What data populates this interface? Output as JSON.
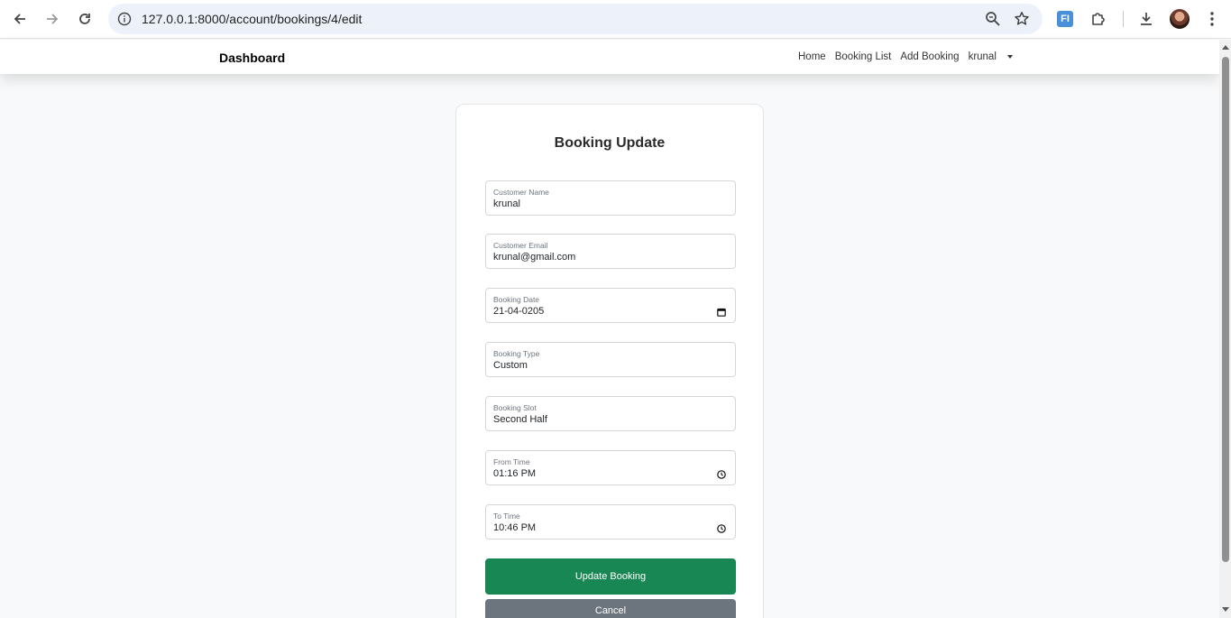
{
  "browser": {
    "url": "127.0.0.1:8000/account/bookings/4/edit",
    "extension_label": "FI"
  },
  "navbar": {
    "brand": "Dashboard",
    "links": [
      "Home",
      "Booking List",
      "Add Booking"
    ],
    "user": "krunal"
  },
  "form": {
    "title": "Booking Update",
    "fields": [
      {
        "label": "Customer Name",
        "value": "krunal"
      },
      {
        "label": "Customer Email",
        "value": "krunal@gmail.com"
      },
      {
        "label": "Booking Date",
        "value": "21-04-0205",
        "icon": "calendar-icon"
      },
      {
        "label": "Booking Type",
        "value": "Custom"
      },
      {
        "label": "Booking Slot",
        "value": "Second Half"
      },
      {
        "label": "From Time",
        "value": "01:16 PM",
        "icon": "clock-icon"
      },
      {
        "label": "To Time",
        "value": "10:46 PM",
        "icon": "clock-icon"
      }
    ],
    "submit_label": "Update Booking",
    "cancel_label": "Cancel"
  },
  "colors": {
    "primary": "#198754",
    "secondary": "#6c757d",
    "page_bg": "#f8f9fa"
  }
}
